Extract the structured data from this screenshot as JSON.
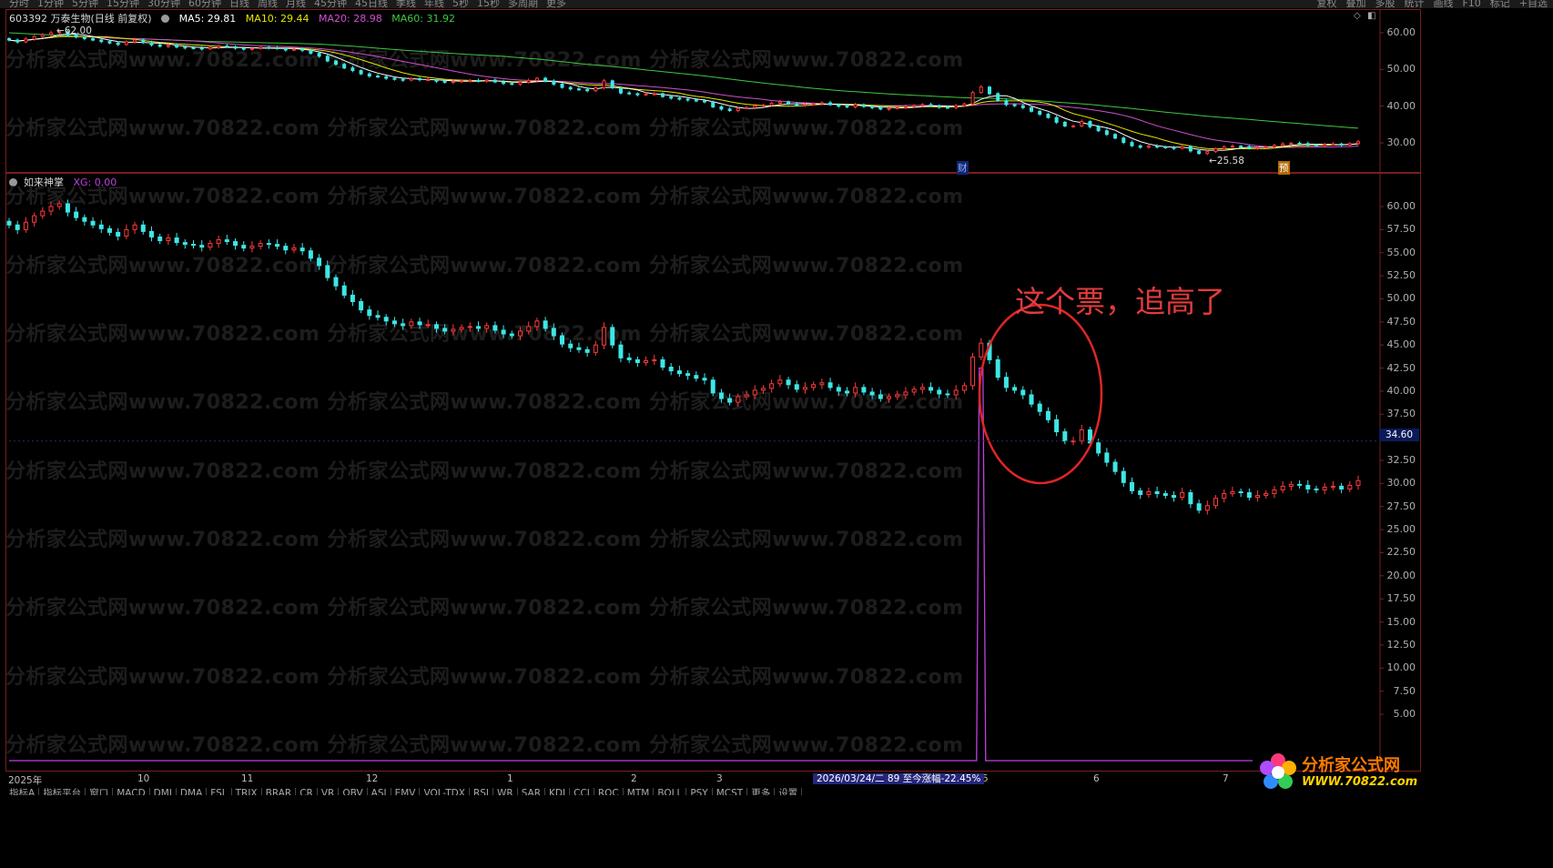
{
  "top_tabs": [
    "分时",
    "1分钟",
    "5分钟",
    "15分钟",
    "30分钟",
    "60分钟",
    "日线",
    "周线",
    "月线",
    "45分钟",
    "45日线",
    "季线",
    "年线",
    "5秒",
    "15秒",
    "多周期",
    "更多"
  ],
  "top_right_tabs": [
    "复权",
    "叠加",
    "多股",
    "统计",
    "画线",
    "F10",
    "标记",
    "+自选"
  ],
  "stock": {
    "header": "603392 万泰生物(日线 前复权)",
    "ma5": "MA5: 29.81",
    "ma10": "MA10: 29.44",
    "ma20": "MA20: 28.98",
    "ma60": "MA60: 31.92",
    "high_mark": "62.00",
    "low_mark": "25.58",
    "flag_cai": "财",
    "flag_yu": "预"
  },
  "indicator": {
    "name": "如来神掌",
    "xg": "XG: 0.00"
  },
  "current_price": "34.60",
  "annotation": "这个票，追高了",
  "range_label": "2026/03/24/二  89  至今涨幅-22.45%",
  "date_labels": [
    "2025年",
    "10",
    "11",
    "12",
    "1",
    "2",
    "3",
    "5",
    "6",
    "7"
  ],
  "bottom_tabs": [
    "指标A",
    "指标平台",
    "窗口",
    "MACD",
    "DMI",
    "DMA",
    "FSL",
    "TRIX",
    "BRAR",
    "CR",
    "VR",
    "OBV",
    "ASI",
    "EMV",
    "VOL-TDX",
    "RSI",
    "WR",
    "SAR",
    "KDJ",
    "CCI",
    "ROC",
    "MTM",
    "BOLL",
    "PSY",
    "MCST",
    "更多",
    "设置"
  ],
  "watermark": "分析家公式网www.70822.com",
  "logo": {
    "title": "分析家公式网",
    "url": "WWW.70822.com"
  },
  "colors": {
    "up": "#ff3a3a",
    "down": "#3ee6e6",
    "ma5": "#ffffff",
    "ma10": "#e6e600",
    "ma20": "#d050d0",
    "ma60": "#3ec83e",
    "xg": "#c040e0",
    "frame": "#7a1e1e"
  },
  "chart_data": [
    {
      "type": "candlestick",
      "panel": "main",
      "y_ticks": [
        "60.00",
        "50.00",
        "40.00",
        "30.00"
      ],
      "ylim": [
        23,
        63
      ],
      "series": [
        {
          "name": "MA5",
          "value": 29.81
        },
        {
          "name": "MA10",
          "value": 29.44
        },
        {
          "name": "MA20",
          "value": 28.98
        },
        {
          "name": "MA60",
          "value": 31.92
        }
      ],
      "close": [
        58,
        57.5,
        58.3,
        59,
        59.5,
        60,
        60.3,
        59.4,
        58.8,
        58.4,
        58,
        57.6,
        57.2,
        56.8,
        57.5,
        58,
        57.3,
        56.7,
        56.3,
        56.6,
        56.1,
        55.9,
        55.8,
        55.6,
        56,
        56.4,
        56.2,
        55.8,
        55.5,
        55.7,
        56,
        55.9,
        55.7,
        55.3,
        55.5,
        55.2,
        54.4,
        53.6,
        52.3,
        51.4,
        50.4,
        49.7,
        48.8,
        48.2,
        48,
        47.6,
        47.3,
        47.1,
        47.5,
        47.2,
        47.2,
        46.8,
        46.5,
        46.7,
        46.9,
        47,
        46.8,
        47.1,
        46.6,
        46.2,
        46,
        46.5,
        47,
        47.6,
        46.8,
        46,
        45.1,
        44.7,
        44.5,
        44.2,
        45,
        46.9,
        45,
        43.6,
        43.4,
        43.1,
        43.3,
        43.4,
        42.6,
        42.2,
        41.9,
        41.7,
        41.4,
        41.2,
        39.8,
        39.2,
        38.8,
        39.4,
        39.6,
        40.1,
        40.3,
        40.8,
        41.2,
        40.7,
        40.2,
        40.4,
        40.7,
        40.9,
        40.4,
        40,
        39.8,
        40.4,
        39.9,
        39.6,
        39.2,
        39.4,
        39.6,
        39.9,
        40.2,
        40.4,
        40.1,
        39.7,
        39.6,
        40.1,
        40.6,
        43.7,
        45.2,
        43.4,
        41.5,
        40.4,
        40.1,
        39.6,
        38.6,
        37.8,
        36.9,
        35.6,
        34.6,
        34.6,
        35.8,
        34.4,
        33.3,
        32.3,
        31.3,
        30.1,
        29.2,
        28.8,
        29.1,
        28.9,
        28.7,
        28.5,
        29,
        27.8,
        27.1,
        27.6,
        28.4,
        28.9,
        29.1,
        29,
        28.5,
        28.7,
        28.9,
        29.3,
        29.7,
        29.9,
        29.8,
        29.4,
        29.3,
        29.6,
        29.7,
        29.4,
        29.8,
        30.3
      ]
    },
    {
      "type": "candlestick",
      "panel": "indicator",
      "name": "如来神掌",
      "y_ticks": [
        "60.00",
        "57.50",
        "55.00",
        "52.50",
        "50.00",
        "47.50",
        "45.00",
        "42.50",
        "40.00",
        "37.50",
        "35.00",
        "32.50",
        "30.00",
        "27.50",
        "25.00",
        "22.50",
        "20.00",
        "17.50",
        "15.00",
        "12.50",
        "10.00",
        "7.50",
        "5.00"
      ],
      "ylim": [
        3,
        61.5
      ],
      "xg_value": 0.0,
      "xg_signal_date": "2026/03/24"
    }
  ]
}
